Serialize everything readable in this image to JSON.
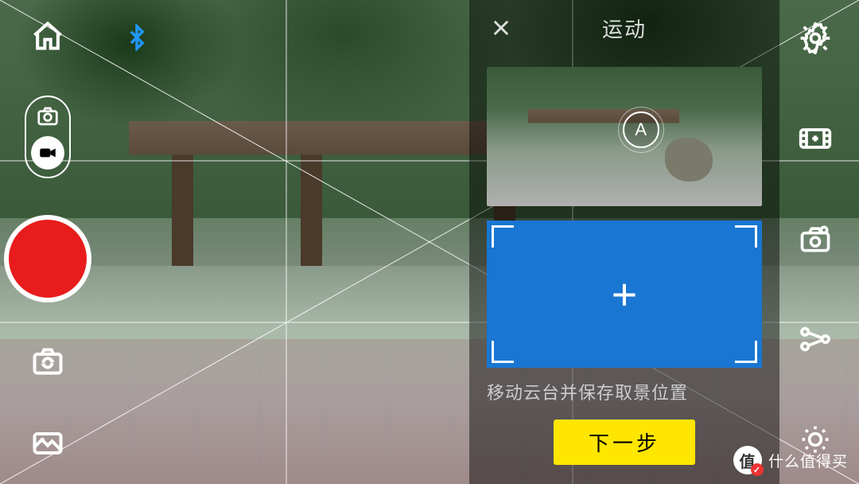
{
  "panel": {
    "title": "运动",
    "markerA": "A",
    "hint": "移动云台并保存取景位置",
    "next": "下一步"
  },
  "watermark": {
    "badge": "值",
    "text": "什么值得买"
  },
  "icons": {
    "home": "home-icon",
    "bluetooth": "bluetooth-icon",
    "modePhoto": "photo-mode-icon",
    "modeVideo": "video-mode-icon",
    "record": "record-button",
    "switchCam": "switch-camera-icon",
    "gallery": "gallery-icon",
    "settings": "settings-gear-icon",
    "filmEffects": "film-effects-icon",
    "cameraSettings": "camera-settings-icon",
    "nodes": "nodes-icon",
    "brightness": "brightness-icon",
    "close": "close-icon",
    "addFrame": "add-frame-icon"
  }
}
